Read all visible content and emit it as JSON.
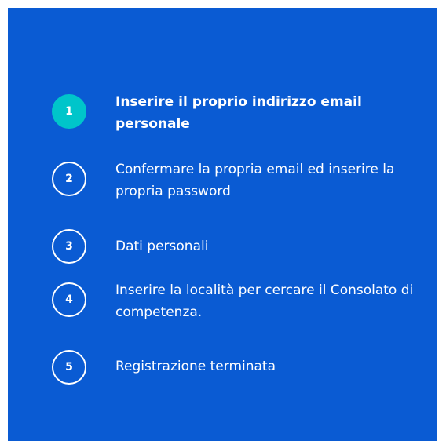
{
  "steps": [
    {
      "number": "1",
      "label": "Inserire il proprio indirizzo email personale",
      "active": true
    },
    {
      "number": "2",
      "label": "Confermare la propria email ed inserire la propria password",
      "active": false
    },
    {
      "number": "3",
      "label": "Dati personali",
      "active": false
    },
    {
      "number": "4",
      "label": "Inserire la località per cercare il Consolato di competenza.",
      "active": false
    },
    {
      "number": "5",
      "label": "Registrazione terminata",
      "active": false
    }
  ],
  "colors": {
    "panel_background": "#0a5bd3",
    "active_step": "#00c5ca",
    "text": "#ffffff"
  }
}
